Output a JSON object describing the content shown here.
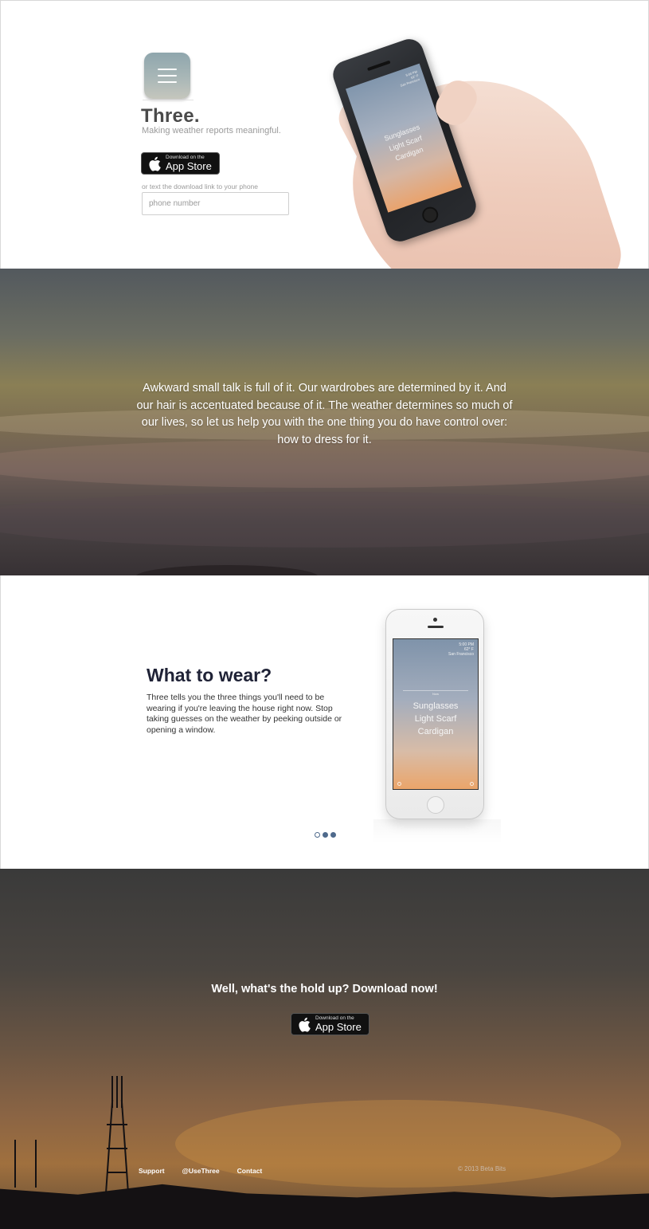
{
  "hero": {
    "brand": "Three.",
    "tagline": "Making weather reports meaningful.",
    "appstore_small": "Download on the",
    "appstore_big": "App Store",
    "sms_hint": "or text the download link to your phone",
    "phone_placeholder": "phone number",
    "phone_screen": {
      "time": "5:00 PM",
      "temp": "62° F",
      "city": "San Francisco",
      "items": [
        "Sunglasses",
        "Light Scarf",
        "Cardigan"
      ]
    }
  },
  "intro": {
    "text": "Awkward small talk is full of it. Our wardrobes are determined by it. And our hair is accentuated because of it. The weather determines so much of our lives, so let us help you with the one thing you do have control over: how to dress for it."
  },
  "feature": {
    "title": "What to wear?",
    "body": "Three tells you the three things you'll need to be wearing if you're leaving the house right now. Stop taking guesses on the weather by peeking outside or opening a window.",
    "phone_screen": {
      "time": "5:00 PM",
      "temp": "62° F",
      "city": "San Francisco",
      "now_label": "Now",
      "items": [
        "Sunglasses",
        "Light Scarf",
        "Cardigan"
      ]
    },
    "carousel": {
      "count": 3,
      "active_index": 1
    }
  },
  "cta": {
    "title": "Well, what's the hold up? Download now!",
    "appstore_small": "Download on the",
    "appstore_big": "App Store"
  },
  "footer": {
    "links": [
      "Support",
      "@UseThree",
      "Contact"
    ],
    "copyright": "© 2013 Beta Bits"
  },
  "colors": {
    "accent": "#4f6a8c",
    "heading": "#1f2236"
  }
}
